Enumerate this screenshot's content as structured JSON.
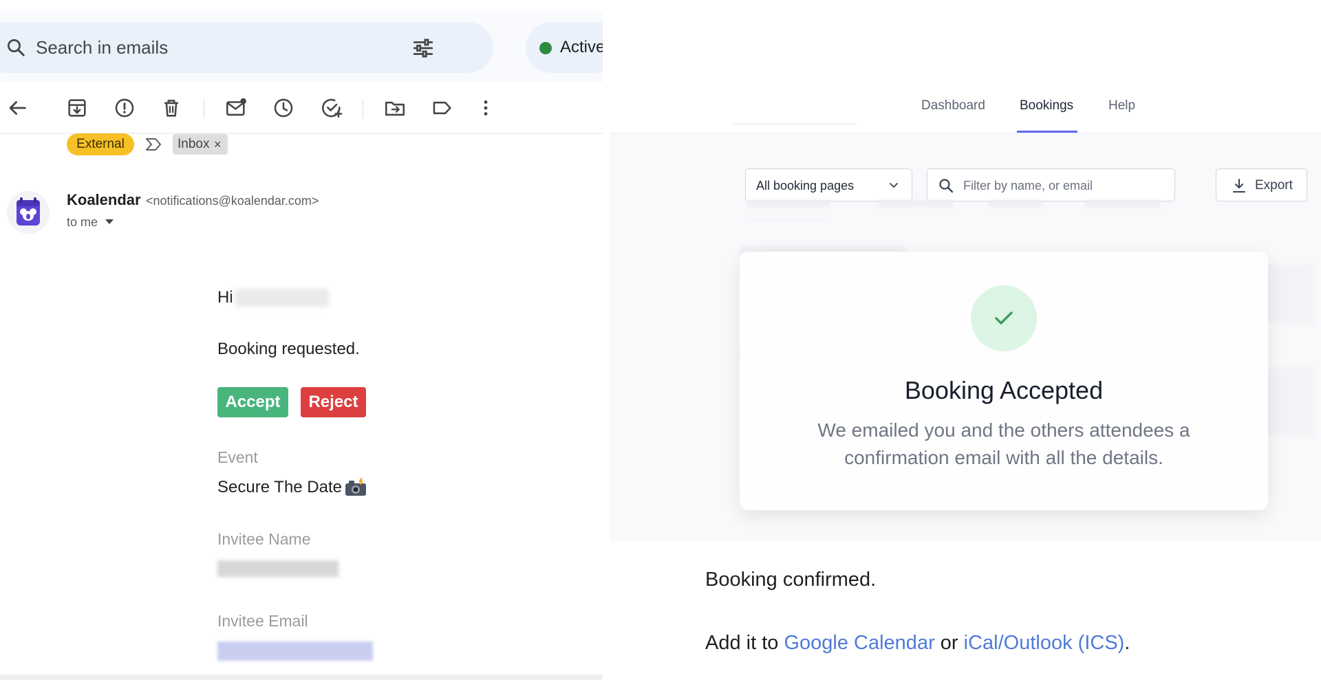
{
  "email_client": {
    "search": {
      "placeholder": "Search in emails",
      "search_icon": "search-icon",
      "filter_icon": "tune-icon"
    },
    "status": {
      "label": "Active",
      "color": "#2e8b3e"
    },
    "toolbar": {
      "icons": [
        "back-arrow-icon",
        "archive-icon",
        "report-spam-icon",
        "delete-icon",
        "mark-unread-icon",
        "snooze-icon",
        "add-task-icon",
        "move-to-icon",
        "label-icon",
        "more-vert-icon"
      ]
    },
    "labels": {
      "external": "External",
      "inbox": "Inbox",
      "inbox_remove": "×"
    },
    "sender": {
      "name": "Koalendar",
      "email": "<notifications@koalendar.com>",
      "recipient": "to me"
    },
    "body": {
      "greeting": "Hi",
      "message": "Booking requested.",
      "accept_label": "Accept",
      "reject_label": "Reject",
      "event_label": "Event",
      "event_value": "Secure The Date",
      "invitee_name_label": "Invitee Name",
      "invitee_email_label": "Invitee Email"
    },
    "colors": {
      "external_tag": "#f6c026",
      "accept": "#48b57d",
      "reject": "#dc3f3f"
    }
  },
  "booking_app": {
    "nav": {
      "dashboard": "Dashboard",
      "bookings": "Bookings",
      "help": "Help",
      "active_color": "#6366f1"
    },
    "filters": {
      "booking_pages": "All booking pages",
      "filter_placeholder": "Filter by name, or email",
      "export_label": "Export"
    },
    "modal": {
      "title": "Booking Accepted",
      "message": "We emailed you and the others attendees a confirmation email with all the details.",
      "icon": "check-icon",
      "icon_bg": "#dcf5e4",
      "icon_color": "#3a9a5c"
    }
  },
  "confirmation": {
    "message": "Booking confirmed.",
    "add_prefix": "Add it to",
    "google_link": "Google Calendar",
    "or_text": "or",
    "ical_link": "iCal/Outlook (ICS)",
    "suffix": ".",
    "link_color": "#4f7ad8"
  }
}
